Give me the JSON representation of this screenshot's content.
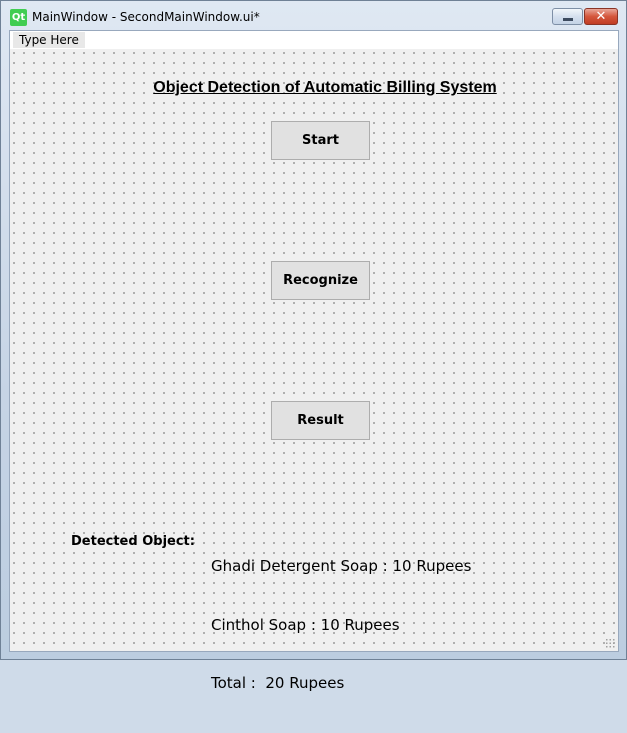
{
  "window": {
    "title": "MainWindow - SecondMainWindow.ui*",
    "logo_text": "Qt",
    "minimize_icon": "minimize-icon",
    "close_icon": "close-icon",
    "close_glyph": "✕"
  },
  "menubar": {
    "placeholder": "Type Here"
  },
  "main": {
    "heading": "Object Detection of Automatic Billing System",
    "buttons": {
      "start": "Start",
      "recognize": "Recognize",
      "result": "Result"
    },
    "detected_label": "Detected Object:",
    "result_lines": [
      "Ghadi Detergent Soap : 10 Rupees",
      "Cinthol Soap : 10 Rupees",
      "Total :  20 Rupees"
    ]
  },
  "colors": {
    "qt_green": "#41cd52",
    "close_red": "#c13d24",
    "button_face": "#e1e1e1"
  }
}
